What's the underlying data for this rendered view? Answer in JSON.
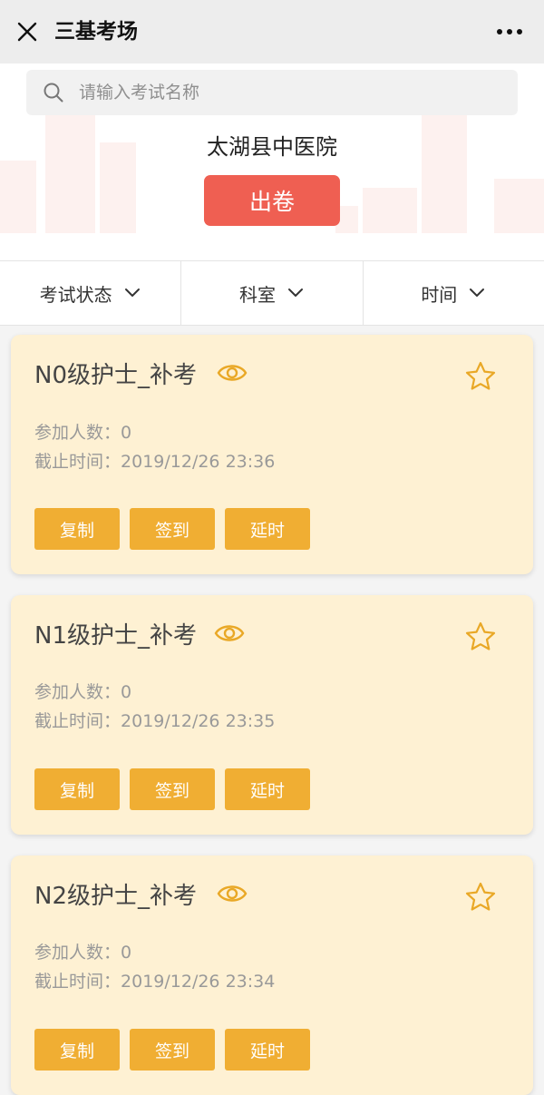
{
  "nav": {
    "title": "三基考场"
  },
  "search": {
    "placeholder": "请输入考试名称"
  },
  "header": {
    "hospital_name": "太湖县中医院",
    "issue_button": "出卷"
  },
  "filters": [
    {
      "label": "考试状态"
    },
    {
      "label": "科室"
    },
    {
      "label": "时间"
    }
  ],
  "labels": {
    "participants": "参加人数：",
    "deadline": "截止时间："
  },
  "exams": [
    {
      "title": "N0级护士_补考",
      "participants": "0",
      "deadline": "2019/12/26 23:36",
      "actions": [
        "复制",
        "签到",
        "延时"
      ]
    },
    {
      "title": "N1级护士_补考",
      "participants": "0",
      "deadline": "2019/12/26 23:35",
      "actions": [
        "复制",
        "签到",
        "延时"
      ]
    },
    {
      "title": "N2级护士_补考",
      "participants": "0",
      "deadline": "2019/12/26 23:34",
      "actions": [
        "复制",
        "签到",
        "延时"
      ]
    }
  ],
  "colors": {
    "accent_red": "#ef5f52",
    "card_bg": "#fef1d3",
    "action_orange": "#f0ae33",
    "icon_gold": "#e9a826"
  }
}
